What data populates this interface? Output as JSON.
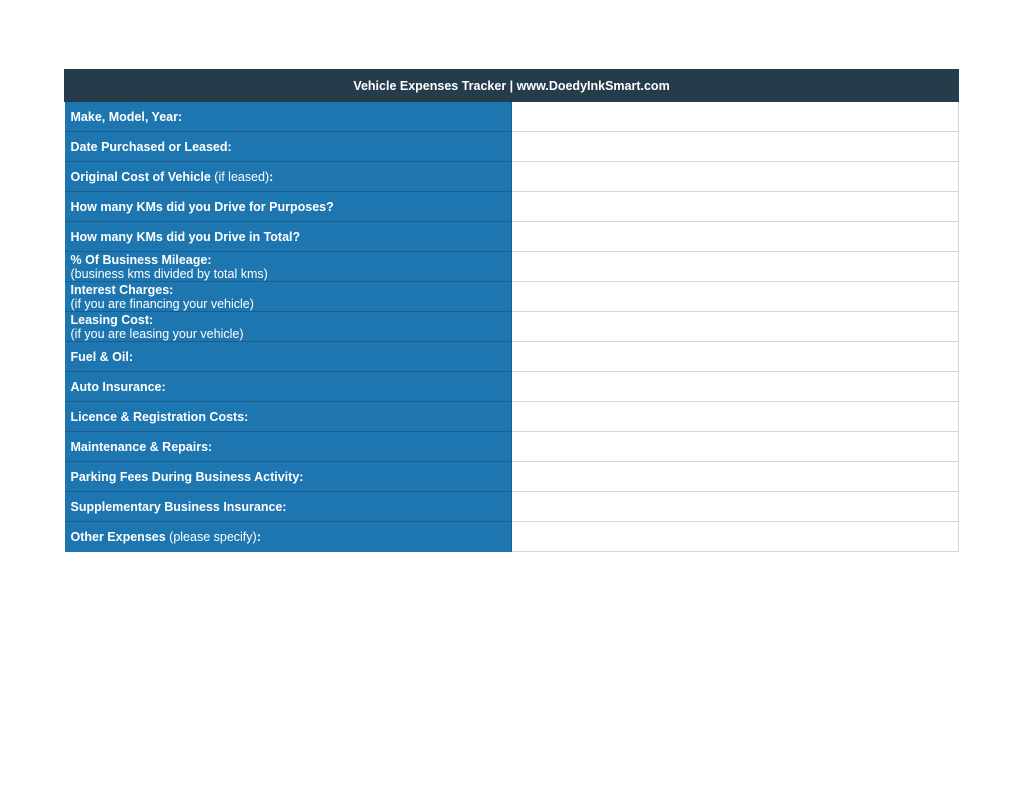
{
  "header": {
    "title": "Vehicle Expenses Tracker | www.DoedyInkSmart.com"
  },
  "rows": [
    {
      "label": "Make, Model, Year:",
      "note": "",
      "note_line": "",
      "value": ""
    },
    {
      "label": "Date Purchased or Leased:",
      "note": "",
      "note_line": "",
      "value": ""
    },
    {
      "label": "Original Cost of Vehicle",
      "note": " (if leased)",
      "suffix": ":",
      "note_line": "",
      "value": ""
    },
    {
      "label": "How many KMs did you Drive for Purposes?",
      "note": "",
      "note_line": "",
      "value": ""
    },
    {
      "label": "How many KMs did you Drive in Total?",
      "note": "",
      "note_line": "",
      "value": ""
    },
    {
      "label": "% Of Business Mileage:",
      "note": "",
      "note_line": "(business kms divided by total kms)",
      "value": ""
    },
    {
      "label": "Interest Charges:",
      "note": "",
      "note_line": "(if you are financing your vehicle)",
      "value": ""
    },
    {
      "label": "Leasing Cost:",
      "note": "",
      "note_line": "(if you are leasing your vehicle)",
      "value": ""
    },
    {
      "label": "Fuel & Oil:",
      "note": "",
      "note_line": "",
      "value": ""
    },
    {
      "label": "Auto Insurance:",
      "note": "",
      "note_line": "",
      "value": ""
    },
    {
      "label": "Licence & Registration Costs:",
      "note": "",
      "note_line": "",
      "value": ""
    },
    {
      "label": "Maintenance & Repairs:",
      "note": "",
      "note_line": "",
      "value": ""
    },
    {
      "label": "Parking Fees During Business Activity:",
      "note": "",
      "note_line": "",
      "value": ""
    },
    {
      "label": "Supplementary Business Insurance:",
      "note": "",
      "note_line": "",
      "value": ""
    },
    {
      "label": "Other Expenses",
      "note": " (please specify)",
      "suffix": ":",
      "note_line": "",
      "value": ""
    }
  ],
  "colors": {
    "header_bg": "#253d4b",
    "label_bg": "#1e76b1",
    "grid_line": "#d6d6d6"
  }
}
